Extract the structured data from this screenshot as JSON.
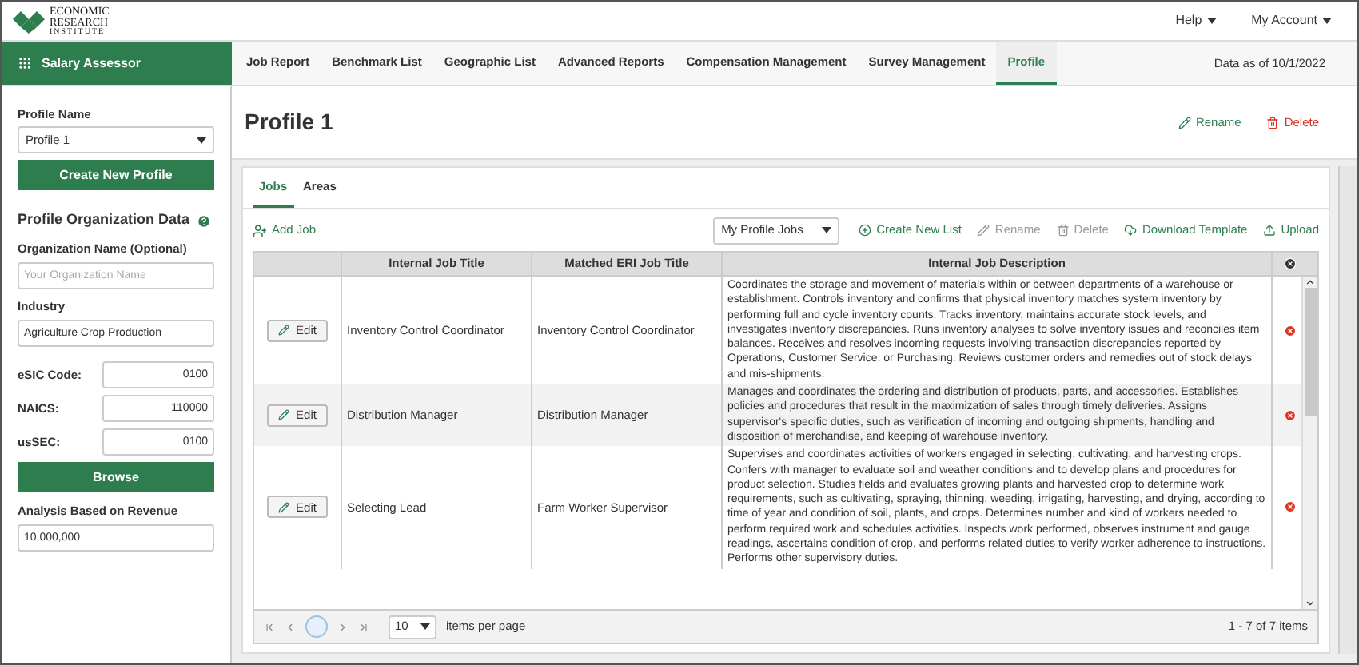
{
  "logo": {
    "lines": [
      "ECONOMIC",
      "RESEARCH",
      "INSTITUTE"
    ]
  },
  "top_links": [
    {
      "label": "Help"
    },
    {
      "label": "My Account"
    }
  ],
  "app": {
    "title": "Salary Assessor"
  },
  "nav_tabs": [
    {
      "label": "Job Report",
      "selected": false
    },
    {
      "label": "Benchmark List",
      "selected": false
    },
    {
      "label": "Geographic List",
      "selected": false
    },
    {
      "label": "Advanced Reports",
      "selected": false
    },
    {
      "label": "Compensation Management",
      "selected": false
    },
    {
      "label": "Survey Management",
      "selected": false
    },
    {
      "label": "Profile",
      "selected": true
    }
  ],
  "data_date": "Data as of 10/1/2022",
  "sidebar": {
    "profile_name_label": "Profile Name",
    "profile_select": "Profile 1",
    "create_button": "Create New Profile",
    "section_title": "Profile Organization Data",
    "fields": [
      {
        "label": "Organization Name (Optional)",
        "placeholder": "Your Organization Name",
        "kind": "stacked"
      },
      {
        "label": "Industry",
        "value": "Agriculture Crop Production",
        "kind": "stacked"
      },
      {
        "label": "eSIC Code:",
        "value": "0100",
        "kind": "inline"
      },
      {
        "label": "NAICS:",
        "value": "110000",
        "kind": "inline"
      },
      {
        "label": "usSEC:",
        "value": "0100",
        "kind": "inline"
      }
    ],
    "browse_button": "Browse",
    "revenue_label": "Analysis Based on Revenue",
    "revenue_value": "10,000,000"
  },
  "page_title": "Profile 1",
  "page_actions": [
    {
      "label": "Rename",
      "kind": "rename"
    },
    {
      "label": "Delete",
      "kind": "delete"
    }
  ],
  "inner_tabs": [
    {
      "label": "Jobs",
      "selected": true
    },
    {
      "label": "Areas",
      "selected": false
    }
  ],
  "toolbar": {
    "add_job": "Add Job",
    "list_select": "My Profile Jobs",
    "actions": [
      {
        "label": "Create New List",
        "kind": "create",
        "disabled": false
      },
      {
        "label": "Rename",
        "kind": "rename",
        "disabled": true
      },
      {
        "label": "Delete",
        "kind": "delete",
        "disabled": true
      },
      {
        "label": "Download Template",
        "kind": "download",
        "disabled": false
      },
      {
        "label": "Upload",
        "kind": "upload",
        "disabled": false
      }
    ]
  },
  "table": {
    "columns": [
      "Internal Job Title",
      "Matched ERI Job Title",
      "Internal Job Description"
    ],
    "rows": [
      {
        "edit": "Edit",
        "internal": "Inventory Control Coordinator",
        "matched": "Inventory Control Coordinator",
        "description": "Coordinates the storage and movement of materials within or between departments of a warehouse or establishment. Controls inventory and confirms that physical inventory matches system inventory by performing full and cycle inventory counts. Tracks inventory, maintains accurate stock levels, and investigates inventory discrepancies. Runs inventory analyses to solve inventory issues and reconciles item balances. Receives and resolves incoming requests involving transaction discrepancies reported by Operations, Customer Service, or Purchasing. Reviews customer orders and remedies out of stock delays and mis-shipments."
      },
      {
        "edit": "Edit",
        "internal": "Distribution Manager",
        "matched": "Distribution Manager",
        "description": "Manages and coordinates the ordering and distribution of products, parts, and accessories. Establishes policies and procedures that result in the maximization of sales through timely deliveries. Assigns supervisor's specific duties, such as verification of incoming and outgoing shipments, handling and disposition of merchandise, and keeping of warehouse inventory."
      },
      {
        "edit": "Edit",
        "internal": "Selecting Lead",
        "matched": "Farm Worker Supervisor",
        "description": "Supervises and coordinates activities of workers engaged in selecting, cultivating, and harvesting crops. Confers with manager to evaluate soil and weather conditions and to develop plans and procedures for product selection. Studies fields and evaluates growing plants and harvested crop to determine work requirements, such as cultivating, spraying, thinning, weeding, irrigating, harvesting, and drying, according to time of year and condition of soil, plants, and crops. Determines number and kind of workers needed to perform required work and schedules activities. Inspects work performed, observes instrument and gauge readings, ascertains condition of crop, and performs related duties to verify worker adherence to instructions. Performs other supervisory duties."
      }
    ]
  },
  "pager": {
    "page_size": "10",
    "per_page_label": "items per page",
    "summary": "1 - 7 of 7 items"
  }
}
